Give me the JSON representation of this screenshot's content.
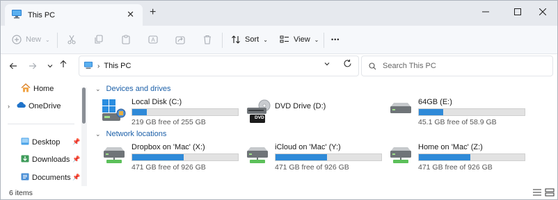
{
  "window": {
    "tab_title": "This PC",
    "tab_close": "✕",
    "new_tab": "+",
    "controls": {
      "minimize": "—",
      "maximize": "☐",
      "close": "✕"
    }
  },
  "toolbar": {
    "new_label": "New",
    "sort_label": "Sort",
    "view_label": "View",
    "more_label": "•••"
  },
  "address": {
    "separator": "›",
    "location": "This PC",
    "search_placeholder": "Search This PC"
  },
  "nav": {
    "home": "Home",
    "onedrive": "OneDrive",
    "pinned": [
      {
        "label": "Desktop"
      },
      {
        "label": "Downloads"
      },
      {
        "label": "Documents"
      }
    ]
  },
  "groups": {
    "devices": "Devices and drives",
    "network": "Network locations"
  },
  "drives": [
    {
      "name": "Local Disk (C:)",
      "free": "219 GB free of 255 GB",
      "used_fraction": 0.14,
      "icon": "windows-drive-icon"
    },
    {
      "name": "DVD Drive (D:)",
      "free": "",
      "used_fraction": null,
      "icon": "dvd-drive-icon",
      "badge": "DVD"
    },
    {
      "name": "64GB (E:)",
      "free": "45.1 GB free of 58.9 GB",
      "used_fraction": 0.23,
      "icon": "usb-drive-icon"
    }
  ],
  "network": [
    {
      "name": "Dropbox on 'Mac' (X:)",
      "free": "471 GB free of 926 GB",
      "used_fraction": 0.49,
      "icon": "network-drive-icon"
    },
    {
      "name": "iCloud on 'Mac' (Y:)",
      "free": "471 GB free of 926 GB",
      "used_fraction": 0.49,
      "icon": "network-drive-icon"
    },
    {
      "name": "Home on 'Mac' (Z:)",
      "free": "471 GB free of 926 GB",
      "used_fraction": 0.49,
      "icon": "network-drive-icon"
    }
  ],
  "status": {
    "item_count": "6 items"
  },
  "colors": {
    "accent": "#2f8ad8",
    "group_header": "#1b5fa8",
    "bar_track": "#e2e2e2"
  }
}
